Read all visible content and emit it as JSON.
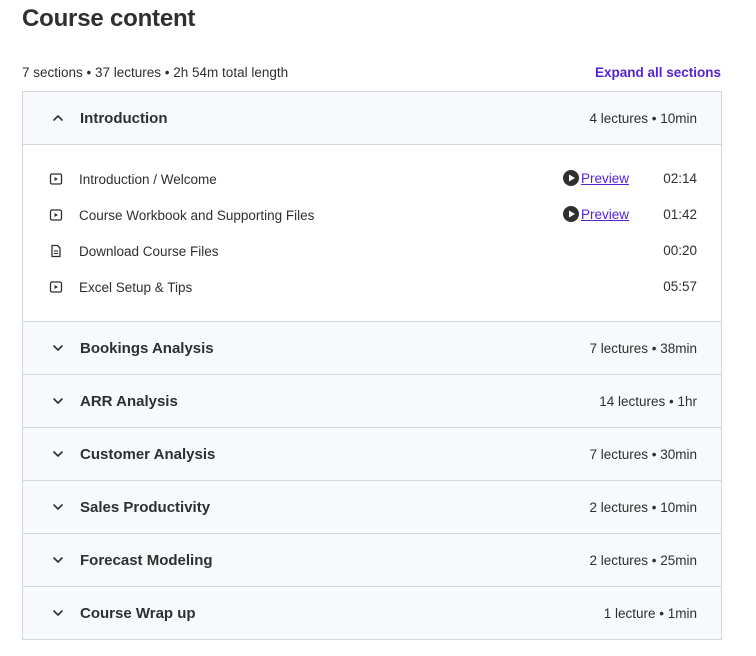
{
  "page": {
    "title": "Course content",
    "summary": "7 sections • 37 lectures • 2h 54m total length",
    "expand_all_label": "Expand all sections"
  },
  "colors": {
    "accent": "#5624d0",
    "text": "#2d2f31",
    "border": "#d1d7dc",
    "section_bg": "#f7f9fa"
  },
  "sections": [
    {
      "title": "Introduction",
      "meta": "4 lectures • 10min",
      "expanded": true,
      "icon": "chevron-up-icon",
      "lectures": [
        {
          "icon": "video-icon",
          "title": "Introduction / Welcome",
          "preview": "Preview",
          "duration": "02:14"
        },
        {
          "icon": "video-icon",
          "title": "Course Workbook and Supporting Files",
          "preview": "Preview",
          "duration": "01:42"
        },
        {
          "icon": "document-icon",
          "title": "Download Course Files",
          "preview": "",
          "duration": "00:20"
        },
        {
          "icon": "video-icon",
          "title": "Excel Setup & Tips",
          "preview": "",
          "duration": "05:57"
        }
      ]
    },
    {
      "title": "Bookings Analysis",
      "meta": "7 lectures • 38min",
      "expanded": false,
      "icon": "chevron-down-icon"
    },
    {
      "title": "ARR Analysis",
      "meta": "14 lectures • 1hr",
      "expanded": false,
      "icon": "chevron-down-icon"
    },
    {
      "title": "Customer Analysis",
      "meta": "7 lectures • 30min",
      "expanded": false,
      "icon": "chevron-down-icon"
    },
    {
      "title": "Sales Productivity",
      "meta": "2 lectures • 10min",
      "expanded": false,
      "icon": "chevron-down-icon"
    },
    {
      "title": "Forecast Modeling",
      "meta": "2 lectures • 25min",
      "expanded": false,
      "icon": "chevron-down-icon"
    },
    {
      "title": "Course Wrap up",
      "meta": "1 lecture • 1min",
      "expanded": false,
      "icon": "chevron-down-icon"
    }
  ]
}
